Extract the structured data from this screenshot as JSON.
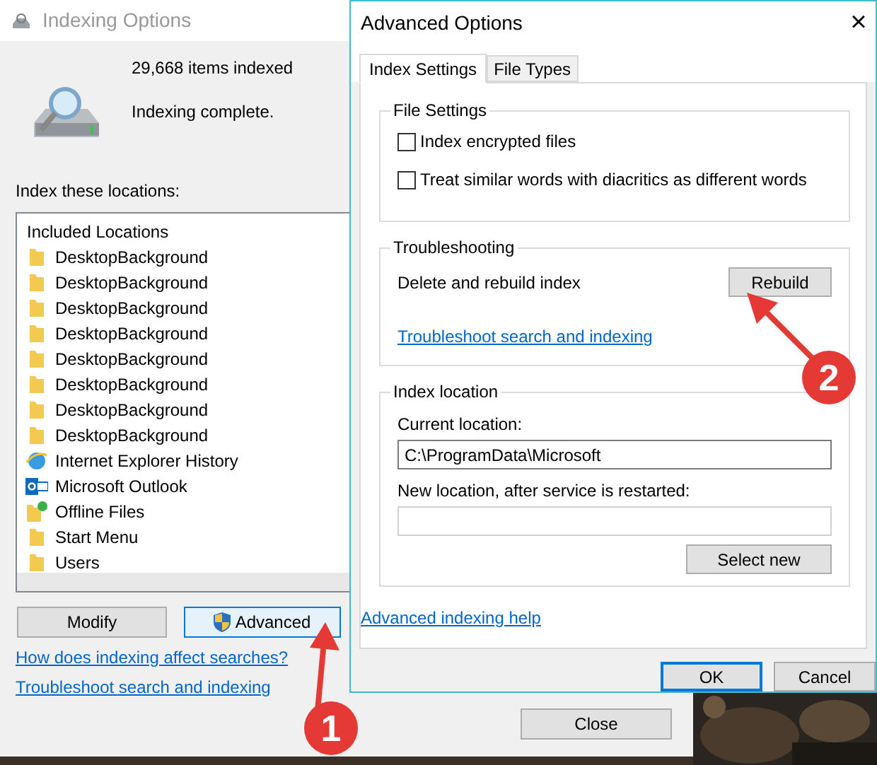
{
  "main_window": {
    "title": "Indexing Options",
    "items_indexed": "29,668 items indexed",
    "status": "Indexing complete.",
    "locations_label": "Index these locations:",
    "list_header": "Included Locations",
    "locations": [
      {
        "kind": "folder",
        "label": "DesktopBackground"
      },
      {
        "kind": "folder",
        "label": "DesktopBackground"
      },
      {
        "kind": "folder",
        "label": "DesktopBackground"
      },
      {
        "kind": "folder",
        "label": "DesktopBackground"
      },
      {
        "kind": "folder",
        "label": "DesktopBackground"
      },
      {
        "kind": "folder",
        "label": "DesktopBackground"
      },
      {
        "kind": "folder",
        "label": "DesktopBackground"
      },
      {
        "kind": "folder",
        "label": "DesktopBackground"
      },
      {
        "kind": "browser",
        "label": "Internet Explorer History"
      },
      {
        "kind": "mail",
        "label": "Microsoft Outlook"
      },
      {
        "kind": "sync",
        "label": "Offline Files"
      },
      {
        "kind": "folder",
        "label": "Start Menu"
      },
      {
        "kind": "folder",
        "label": "Users"
      }
    ],
    "buttons": [
      {
        "label": "Modify",
        "kind": "plain"
      },
      {
        "label": "Advanced",
        "kind": "shield"
      }
    ],
    "links": [
      "How does indexing affect searches?",
      "Troubleshoot search and indexing"
    ],
    "close_button": "Close"
  },
  "dialog": {
    "title": "Advanced Options",
    "close": "×",
    "tabs": [
      {
        "label": "Index Settings",
        "selected": true
      },
      {
        "label": "File Types",
        "selected": false
      }
    ],
    "file_settings": {
      "title": "File Settings",
      "options": [
        {
          "label": "Index encrypted files",
          "checked": false
        },
        {
          "label": "Treat similar words with diacritics as different words",
          "checked": false
        }
      ]
    },
    "troubleshooting": {
      "title": "Troubleshooting",
      "text": "Delete and rebuild index",
      "button": "Rebuild",
      "link": "Troubleshoot search and indexing"
    },
    "index_location": {
      "title": "Index location",
      "current_label": "Current location:",
      "current_value": "C:\\ProgramData\\Microsoft",
      "new_label": "New location, after service is restarted:",
      "button": "Select new"
    },
    "help_link": "Advanced indexing help",
    "buttons": [
      {
        "label": "OK",
        "selected": true
      },
      {
        "label": "Cancel",
        "selected": false
      }
    ]
  },
  "annotations": [
    {
      "label": "1"
    },
    {
      "label": "2"
    }
  ]
}
